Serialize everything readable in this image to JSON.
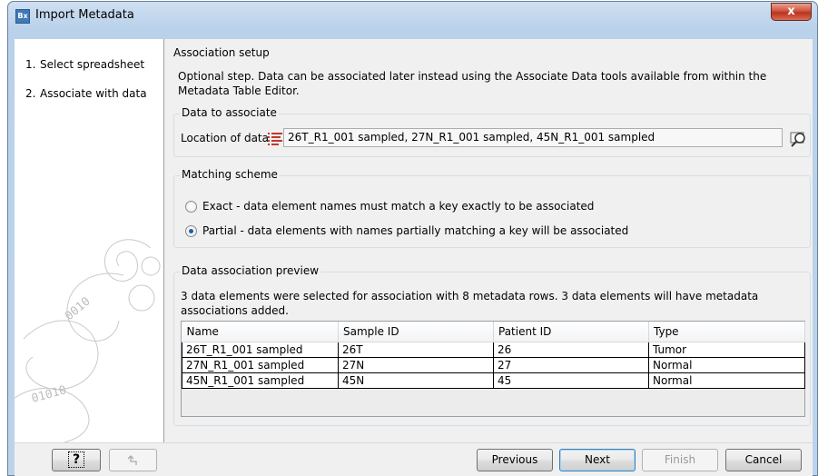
{
  "window": {
    "title": "Import Metadata",
    "app_icon_text": "Bx",
    "close_label": "x"
  },
  "steps": [
    {
      "num": "1.",
      "label": "Select spreadsheet"
    },
    {
      "num": "2.",
      "label": "Associate with data"
    }
  ],
  "main": {
    "section_title": "Association setup",
    "description": "Optional step. Data can be associated later instead using the Associate Data tools available from within the Metadata Table Editor."
  },
  "data_to_associate": {
    "group_title": "Data to associate",
    "location_label": "Location of data",
    "location_value": "26T_R1_001 sampled, 27N_R1_001 sampled, 45N_R1_001 sampled"
  },
  "matching_scheme": {
    "group_title": "Matching scheme",
    "options": [
      {
        "label": "Exact - data element names must match a key exactly to be associated",
        "selected": false
      },
      {
        "label": "Partial - data elements with names partially matching a key will be associated",
        "selected": true
      }
    ]
  },
  "preview": {
    "group_title": "Data association preview",
    "note": "3 data elements were selected for association with 8 metadata rows. 3 data elements will have metadata associations added.",
    "columns": [
      "Name",
      "Sample ID",
      "Patient ID",
      "Type"
    ],
    "rows": [
      [
        "26T_R1_001 sampled",
        "26T",
        "26",
        "Tumor"
      ],
      [
        "27N_R1_001 sampled",
        "27N",
        "27",
        "Normal"
      ],
      [
        "45N_R1_001 sampled",
        "45N",
        "45",
        "Normal"
      ]
    ]
  },
  "footer": {
    "help_label": "?",
    "previous_label": "Previous",
    "next_label": "Next",
    "finish_label": "Finish",
    "cancel_label": "Cancel"
  }
}
